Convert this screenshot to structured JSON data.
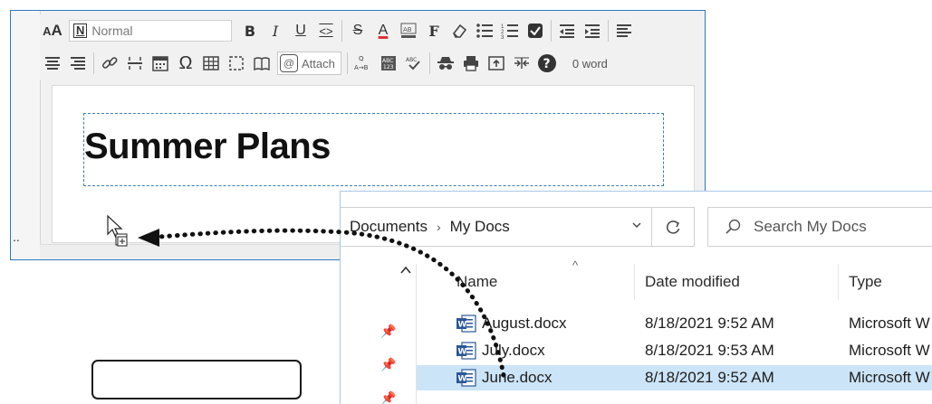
{
  "editor": {
    "style_select_value": "Normal",
    "style_select_icon": "N",
    "attach_label": "Attach",
    "word_count": "0 word",
    "left_strip_text": "..",
    "document_title": "Summer Plans",
    "toolbar_row1": [
      "font-size-icon",
      "style-select",
      "bold-icon",
      "italic-icon",
      "underline-icon",
      "source-code-icon",
      "strikethrough-icon",
      "font-color-icon",
      "highlight-icon",
      "format-icon",
      "eraser-icon",
      "bullet-list-icon",
      "numbered-list-icon",
      "checkbox-icon",
      "outdent-icon",
      "indent-icon",
      "align-icon"
    ],
    "toolbar_row2": [
      "align-left-icon",
      "align-right-icon",
      "link-icon",
      "horizontal-rule-icon",
      "calendar-icon",
      "omega-icon",
      "table-icon",
      "frame-icon",
      "book-icon",
      "attach-button",
      "find-replace-icon",
      "spellcheck-icon",
      "spellcheck-small-icon",
      "spy-icon",
      "print-icon",
      "export-icon",
      "collapse-icon",
      "help-icon"
    ]
  },
  "explorer": {
    "breadcrumb": [
      "Documents",
      "My Docs"
    ],
    "search_placeholder": "Search My Docs",
    "columns": {
      "name": "Name",
      "date": "Date modified",
      "type": "Type"
    },
    "files": [
      {
        "name": "August.docx",
        "date": "8/18/2021 9:52 AM",
        "type": "Microsoft W",
        "selected": false
      },
      {
        "name": "July.docx",
        "date": "8/18/2021 9:53 AM",
        "type": "Microsoft W",
        "selected": false
      },
      {
        "name": "June.docx",
        "date": "8/18/2021 9:52 AM",
        "type": "Microsoft W",
        "selected": true
      }
    ]
  },
  "colors": {
    "accent": "#2e78c2",
    "selected_row": "#cce4f7",
    "title_border": "#3f7db6"
  }
}
